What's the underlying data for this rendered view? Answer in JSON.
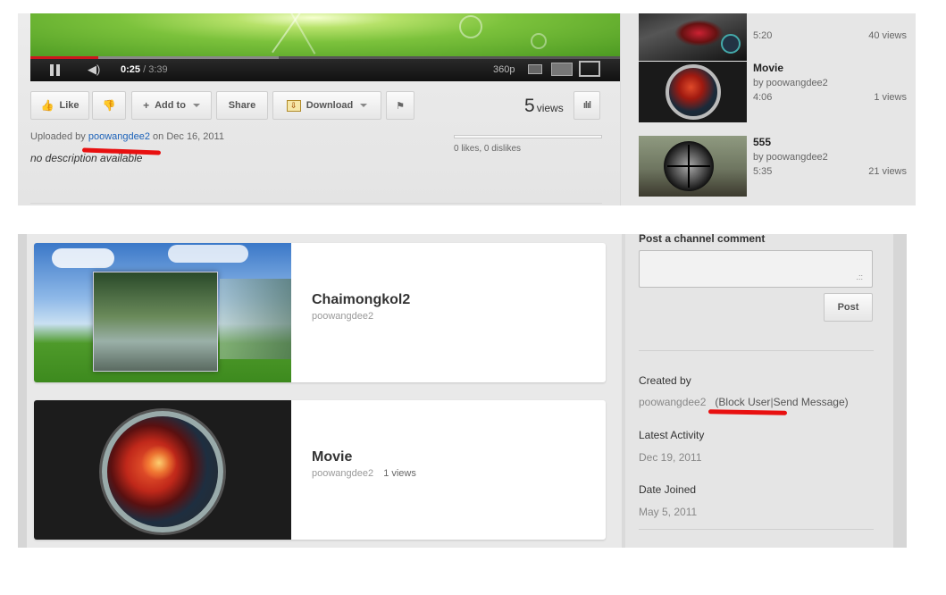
{
  "player": {
    "time_current": "0:25",
    "time_total": "/ 3:39",
    "quality": "360p",
    "progress": 0.115
  },
  "actions": {
    "like_label": "Like",
    "add_to_label": "Add to",
    "share_label": "Share",
    "download_label": "Download",
    "views_number": "5",
    "views_word": "views"
  },
  "upload": {
    "prefix": "Uploaded by",
    "user": "poowangdee2",
    "date": "on Dec 16, 2011",
    "description": "no description available",
    "likes_text": "0 likes, 0 dislikes"
  },
  "related": [
    {
      "title": "",
      "by": "",
      "duration": "5:20",
      "views": "40 views"
    },
    {
      "title": "Movie",
      "by": "by poowangdee2",
      "duration": "4:06",
      "views": "1 views"
    },
    {
      "title": "555",
      "by": "by poowangdee2",
      "duration": "5:35",
      "views": "21 views"
    }
  ],
  "channel_videos": [
    {
      "title": "Chaimongkol2",
      "user": "poowangdee2",
      "views": ""
    },
    {
      "title": "Movie",
      "user": "poowangdee2",
      "views": "1 views"
    }
  ],
  "sidebar": {
    "post_comment_label": "Post a channel comment",
    "post_button": "Post",
    "comment_grip": ".::",
    "created_by_label": "Created by",
    "created_by_user": "poowangdee2",
    "block_user": "(Block User",
    "send_message": "Send Message)",
    "latest_activity_label": "Latest Activity",
    "latest_activity_value": "Dec 19, 2011",
    "date_joined_label": "Date Joined",
    "date_joined_value": "May 5, 2011"
  },
  "colors": {
    "link_blue": "#1c62b9",
    "annotation_red": "#e81010",
    "progress_red": "#cc181e"
  },
  "icons": {
    "like": "thumbs-up-icon",
    "dislike": "thumbs-down-icon",
    "add": "plus-icon",
    "download": "download-icon",
    "flag": "flag-icon",
    "stats": "bar-chart-icon",
    "pause": "pause-icon",
    "volume": "volume-icon",
    "fullscreen": "fullscreen-icon"
  }
}
